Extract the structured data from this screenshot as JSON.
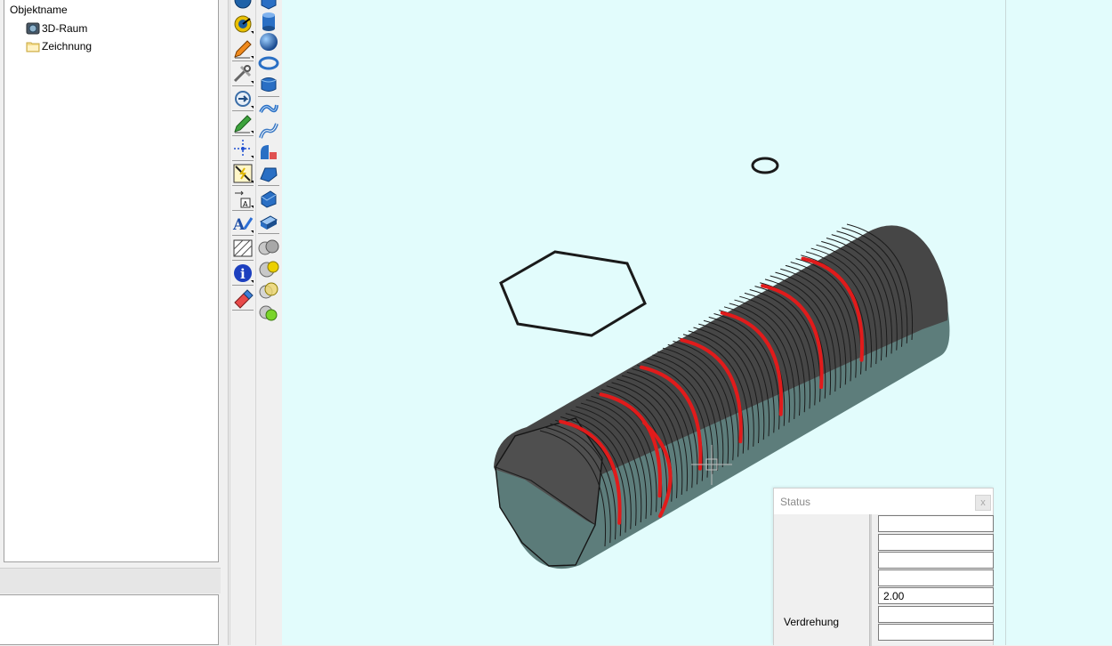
{
  "tree": {
    "header": "Objektname",
    "items": [
      {
        "label": "3D-Raum",
        "icon": "3d-space-icon"
      },
      {
        "label": "Zeichnung",
        "icon": "folder-icon"
      }
    ]
  },
  "toolbar_left": {
    "buttons": [
      "globe-icon",
      "snap-icon",
      "pencil-draw-icon",
      "tools-icon",
      "rotate-icon",
      "pen-edit-icon",
      "crosshair-points-icon",
      "measure-icon",
      "dimension-icon",
      "text-icon",
      "hatch-icon",
      "info-icon",
      "eraser-icon"
    ]
  },
  "toolbar_right": {
    "buttons": [
      "box-icon",
      "cylinder-icon",
      "sphere-icon",
      "torus-icon",
      "chamfer-cylinder-icon",
      "sweep-icon",
      "pipe-icon",
      "solid-cut-icon",
      "wedge-icon",
      "extrude-icon",
      "slab-icon",
      "boolean-union-icon",
      "boolean-subtract-icon",
      "boolean-intersect-icon",
      "render-icon"
    ]
  },
  "status_dialog": {
    "title": "Status",
    "close_label": "x",
    "label": "Verdrehung",
    "fields": [
      "",
      "",
      "",
      "",
      "2.00",
      "",
      ""
    ]
  },
  "colors": {
    "canvas_background": "#e2fcfc",
    "helix": "#e11b1b",
    "solid_top": "#474747",
    "solid_bottom": "#5a7a78"
  }
}
